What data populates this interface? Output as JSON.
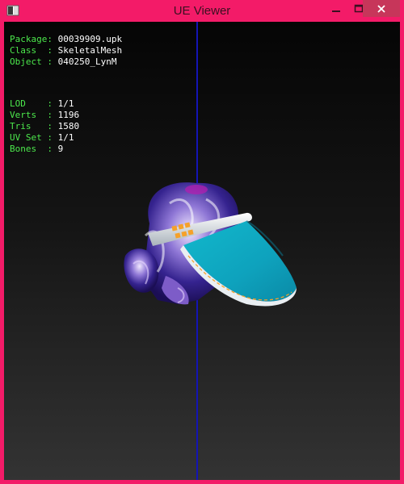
{
  "window": {
    "title": "UE Viewer",
    "colors": {
      "frame": "#f31b68",
      "close_button": "#c7365a",
      "label_text": "#4ce84c",
      "value_text": "#ffffff",
      "axis_line": "#1414b4"
    }
  },
  "controls": {
    "minimize_icon": "minimize-icon",
    "maximize_icon": "maximize-icon",
    "close_icon": "close-icon"
  },
  "mesh_info": {
    "package_label": "Package",
    "package_value": "00039909.upk",
    "class_label": "Class  ",
    "class_value": "SkeletalMesh",
    "object_label": "Object ",
    "object_value": "040250_LynM",
    "lod_label": "LOD    ",
    "lod_value": "1/1",
    "verts_label": "Verts  ",
    "verts_value": "1196",
    "tris_label": "Tris   ",
    "tris_value": "1580",
    "uvset_label": "UV Set ",
    "uvset_value": "1/1",
    "bones_label": "Bones  ",
    "bones_value": "9"
  }
}
